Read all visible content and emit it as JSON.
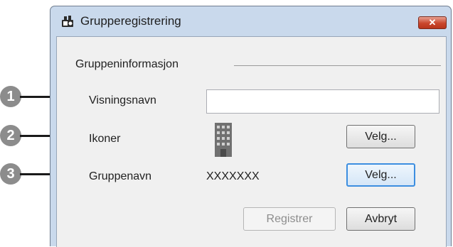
{
  "window": {
    "title": "Grupperegistrering",
    "close_glyph": "✕"
  },
  "group": {
    "title": "Gruppeninformasjon"
  },
  "fields": {
    "display_name_label": "Visningsnavn",
    "display_name_value": "",
    "icons_label": "Ikoner",
    "group_name_label": "Gruppenavn",
    "group_name_value": "XXXXXXX"
  },
  "buttons": {
    "select_icon": "Velg...",
    "select_group": "Velg...",
    "register": "Registrer",
    "cancel": "Avbryt"
  },
  "callouts": [
    "1",
    "2",
    "3"
  ],
  "icons": {
    "app": "projector-group-icon",
    "icon_preview": "building-icon",
    "close": "close-icon"
  },
  "colors": {
    "callout": "#8c8c8c",
    "close_button": "#c9462c",
    "default_button_border": "#3c8ee0"
  }
}
